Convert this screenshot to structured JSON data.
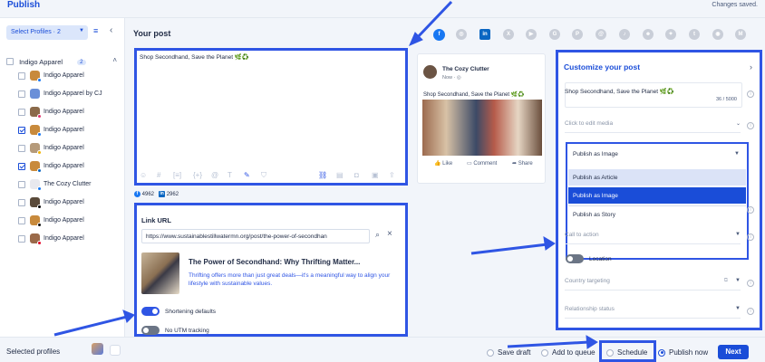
{
  "header": {
    "title": "Publish",
    "status": "Changes saved."
  },
  "left": {
    "select_profiles": "Select Profiles · 2",
    "group": {
      "name": "Indigo Apparel",
      "count": "2"
    },
    "profiles": [
      {
        "label": "Indigo Apparel",
        "checked": false,
        "net": "facebook"
      },
      {
        "label": "Indigo Apparel by CJ",
        "checked": false,
        "net": "none"
      },
      {
        "label": "Indigo Apparel",
        "checked": false,
        "net": "instagram"
      },
      {
        "label": "Indigo Apparel",
        "checked": true,
        "net": "facebook"
      },
      {
        "label": "Indigo Apparel",
        "checked": false,
        "net": "google"
      },
      {
        "label": "Indigo Apparel",
        "checked": true,
        "net": "linkedin"
      },
      {
        "label": "The Cozy Clutter",
        "checked": false,
        "net": "facebook"
      },
      {
        "label": "Indigo Apparel",
        "checked": false,
        "net": "tiktok"
      },
      {
        "label": "Indigo Apparel",
        "checked": false,
        "net": "threads"
      },
      {
        "label": "Indigo Apparel",
        "checked": false,
        "net": "pinterest"
      }
    ]
  },
  "center": {
    "your_post": "Your post",
    "post_text": "Shop Secondhand, Save the Planet 🌿♻️",
    "fb_count": "4962",
    "li_count": "2962",
    "link": {
      "title": "Link URL",
      "url": "https://www.sustainablestillwatermn.org/post/the-power-of-secondhan",
      "card_title": "The Power of Secondhand: Why Thrifting Matter...",
      "card_desc": "Thrifting offers more than just great deals—it's a meaningful way to align your lifestyle with sustainable values.",
      "shortening": "Shortening defaults",
      "utm": "No UTM tracking"
    }
  },
  "preview": {
    "name": "The Cozy Clutter",
    "time": "Now · ◎",
    "text": "Shop Secondhand, Save the Planet 🌿♻️",
    "like": "Like",
    "comment": "Comment",
    "share": "Share"
  },
  "right": {
    "title": "Customize your post",
    "text": "Shop Secondhand, Save the Planet 🌿♻️",
    "char_count": "36 / 5000",
    "edit_media": "Click to edit media",
    "publish_as": "Publish as Image",
    "options": [
      "Publish as Article",
      "Publish as Image",
      "Publish as Story"
    ],
    "call_to_action": "Call to action",
    "location": "Location",
    "country": "Country targeting",
    "relationship": "Relationship status"
  },
  "footer": {
    "selected_profiles": "Selected profiles",
    "save_draft": "Save draft",
    "add_queue": "Add to queue",
    "schedule": "Schedule",
    "publish_now": "Publish now",
    "next": "Next"
  },
  "colors": {
    "accent": "#1a4dd8",
    "highlight": "#2f55e4"
  }
}
